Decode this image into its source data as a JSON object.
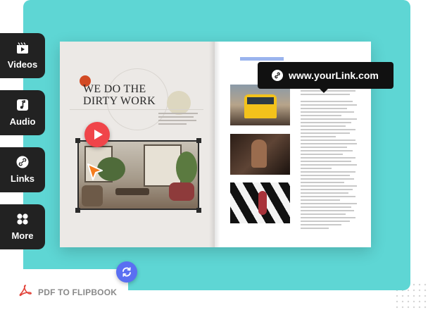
{
  "sidebar": {
    "items": [
      {
        "label": "Videos",
        "icon": "video-icon"
      },
      {
        "label": "Audio",
        "icon": "music-note-icon"
      },
      {
        "label": "Links",
        "icon": "link-icon"
      },
      {
        "label": "More",
        "icon": "grid-icon"
      }
    ]
  },
  "flipbook": {
    "headline_line1": "WE DO THE",
    "headline_line2": "DIRTY WORK",
    "video_play_icon": "play-icon",
    "photos": [
      "tram-photo",
      "portrait-photo",
      "crosswalk-photo"
    ]
  },
  "link_badge": {
    "text": "www.yourLink.com",
    "icon": "link-icon"
  },
  "footer": {
    "label": "PDF TO FLIPBOOK",
    "icon": "pdf-icon"
  },
  "convert_icon": "refresh-icon",
  "colors": {
    "teal_background": "#5ed6d4",
    "sidebar_button": "#222222",
    "play_button": "#f0454a",
    "cursor": "#f47c1e",
    "convert_button": "#5a6ff2",
    "pdf_red": "#e2443b",
    "link_badge": "#111111"
  }
}
